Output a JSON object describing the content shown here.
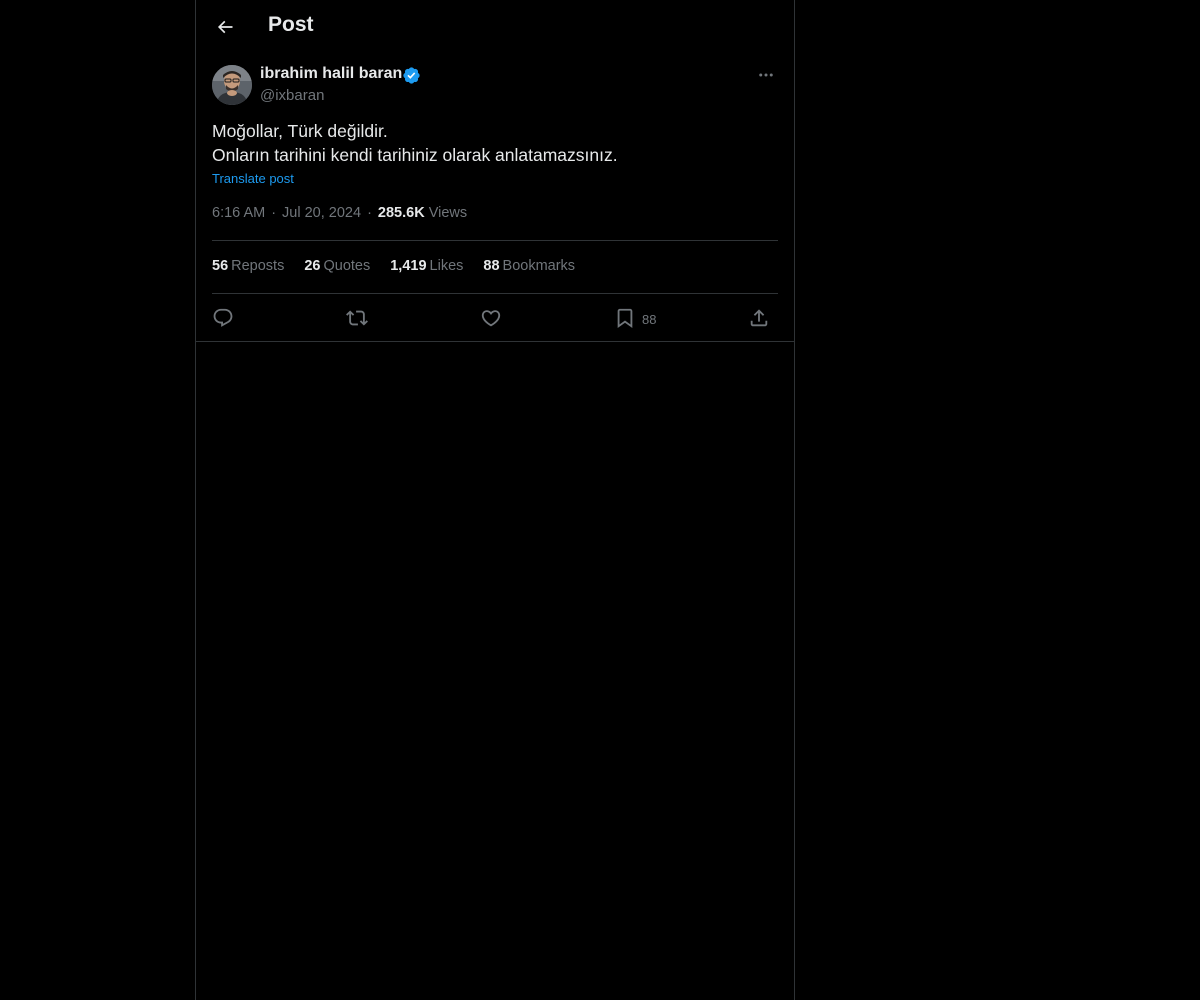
{
  "header": {
    "back_icon": "arrow-left-icon",
    "title": "Post"
  },
  "author": {
    "display_name": "ibrahim halil baran",
    "handle": "@ixbaran",
    "verified": true,
    "verified_icon": "verified-badge-icon",
    "more_icon": "more-horizontal-icon"
  },
  "post": {
    "lines": [
      "Moğollar, Türk değildir.",
      "Onların tarihini kendi tarihiniz olarak anlatamazsınız."
    ],
    "translate_label": "Translate post"
  },
  "meta": {
    "time": "6:16 AM",
    "separator": "·",
    "date": "Jul 20, 2024",
    "views_count": "285.6K",
    "views_label": "Views"
  },
  "stats": [
    {
      "count": "56",
      "label": "Reposts"
    },
    {
      "count": "26",
      "label": "Quotes"
    },
    {
      "count": "1,419",
      "label": "Likes"
    },
    {
      "count": "88",
      "label": "Bookmarks"
    }
  ],
  "actions": {
    "reply_icon": "reply-icon",
    "repost_icon": "repost-icon",
    "like_icon": "heart-icon",
    "bookmark_icon": "bookmark-icon",
    "bookmark_count": "88",
    "share_icon": "share-icon"
  },
  "colors": {
    "background": "#000000",
    "text": "#e7e9ea",
    "secondary": "#71767b",
    "accent": "#1d9bf0",
    "border": "#2f3336"
  }
}
